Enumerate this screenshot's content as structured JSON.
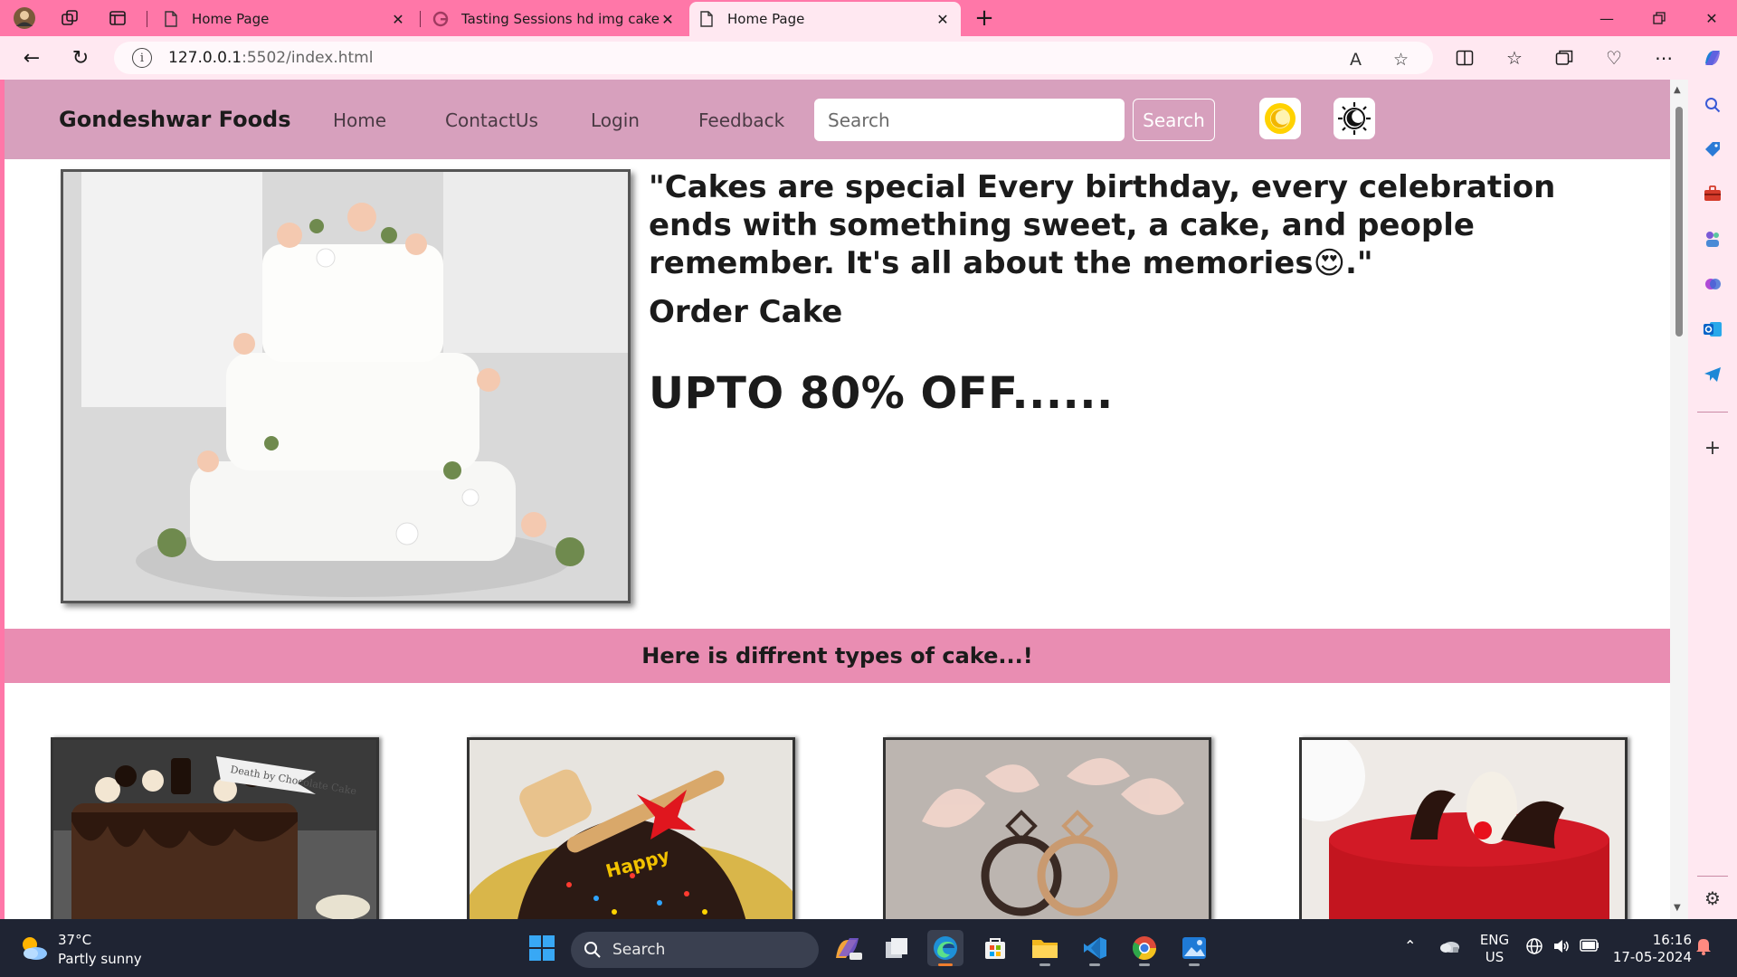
{
  "browser": {
    "tabs": [
      {
        "title": "Home Page",
        "active": false
      },
      {
        "title": "Tasting Sessions hd img cake - G",
        "active": false
      },
      {
        "title": "Home Page",
        "active": true
      }
    ],
    "url_host": "127.0.0.1",
    "url_rest": ":5502/index.html"
  },
  "site": {
    "brand": "Gondeshwar Foods",
    "nav": [
      "Home",
      "ContactUs",
      "Login",
      "Feedback"
    ],
    "search_placeholder": "Search",
    "search_button": "Search",
    "quote": "\"Cakes are special Every birthday, every celebration ends with something sweet, a cake, and people remember. It's all about the memories😍.\"",
    "order": "Order Cake",
    "offer": "UPTO 80% OFF......",
    "banner": "Here is diffrent types of cake...!",
    "card4_topper": "Death by Chocolate Cake"
  },
  "taskbar": {
    "temp": "37°C",
    "weather": "Partly sunny",
    "search": "Search",
    "lang1": "ENG",
    "lang2": "US",
    "time": "16:16",
    "date": "17-05-2024"
  },
  "colors": {
    "chrome": "#ff77a8",
    "navbar": "#d7a0bd",
    "banner": "#e98db2",
    "taskbar": "#1f2433"
  }
}
